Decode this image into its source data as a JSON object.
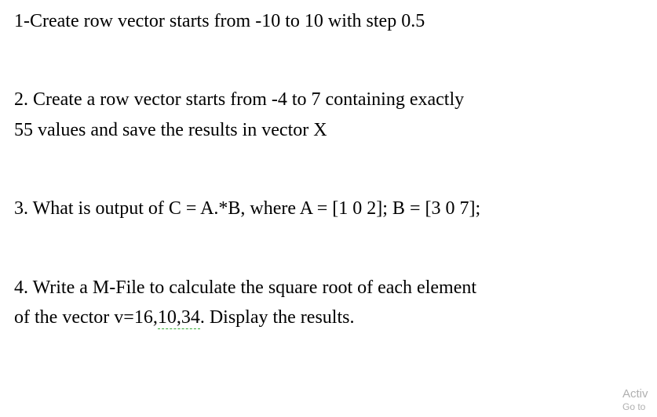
{
  "questions": {
    "q1": "1-Create row vector starts from -10 to 10 with step 0.5",
    "q2a": "2. Create a row vector starts from -4 to 7 containing exactly",
    "q2b": "55 values and save the results in vector X",
    "q3": "3. What is output of C = A.*B, where A = [1 0 2]; B = [3 0 7];",
    "q4a": "4. Write a M-File to calculate the square root of each element",
    "q4b_pre": "of the vector v=16,",
    "q4b_u": "10,34",
    "q4b_post": ". Display the results."
  },
  "watermark": {
    "line1": "Activ",
    "line2": "Go to "
  }
}
